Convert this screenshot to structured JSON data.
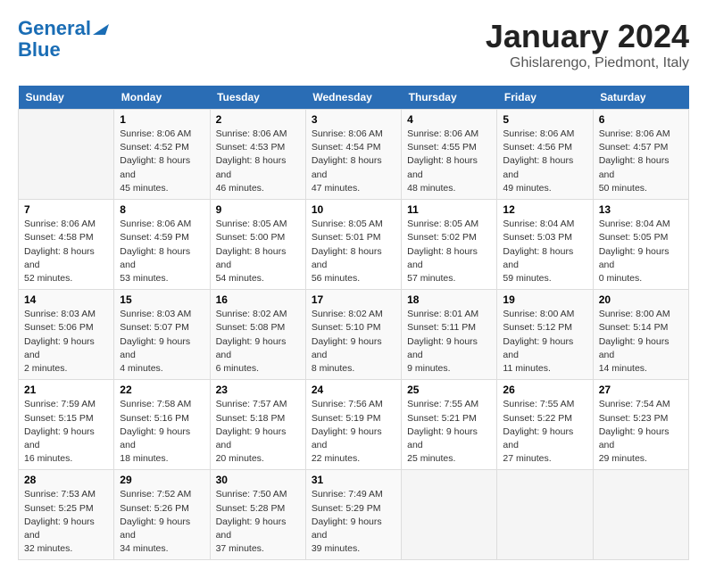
{
  "header": {
    "logo_line1": "General",
    "logo_line2": "Blue",
    "month": "January 2024",
    "location": "Ghislarengo, Piedmont, Italy"
  },
  "weekdays": [
    "Sunday",
    "Monday",
    "Tuesday",
    "Wednesday",
    "Thursday",
    "Friday",
    "Saturday"
  ],
  "weeks": [
    [
      {
        "day": "",
        "sunrise": "",
        "sunset": "",
        "daylight": ""
      },
      {
        "day": "1",
        "sunrise": "Sunrise: 8:06 AM",
        "sunset": "Sunset: 4:52 PM",
        "daylight": "Daylight: 8 hours and 45 minutes."
      },
      {
        "day": "2",
        "sunrise": "Sunrise: 8:06 AM",
        "sunset": "Sunset: 4:53 PM",
        "daylight": "Daylight: 8 hours and 46 minutes."
      },
      {
        "day": "3",
        "sunrise": "Sunrise: 8:06 AM",
        "sunset": "Sunset: 4:54 PM",
        "daylight": "Daylight: 8 hours and 47 minutes."
      },
      {
        "day": "4",
        "sunrise": "Sunrise: 8:06 AM",
        "sunset": "Sunset: 4:55 PM",
        "daylight": "Daylight: 8 hours and 48 minutes."
      },
      {
        "day": "5",
        "sunrise": "Sunrise: 8:06 AM",
        "sunset": "Sunset: 4:56 PM",
        "daylight": "Daylight: 8 hours and 49 minutes."
      },
      {
        "day": "6",
        "sunrise": "Sunrise: 8:06 AM",
        "sunset": "Sunset: 4:57 PM",
        "daylight": "Daylight: 8 hours and 50 minutes."
      }
    ],
    [
      {
        "day": "7",
        "sunrise": "Sunrise: 8:06 AM",
        "sunset": "Sunset: 4:58 PM",
        "daylight": "Daylight: 8 hours and 52 minutes."
      },
      {
        "day": "8",
        "sunrise": "Sunrise: 8:06 AM",
        "sunset": "Sunset: 4:59 PM",
        "daylight": "Daylight: 8 hours and 53 minutes."
      },
      {
        "day": "9",
        "sunrise": "Sunrise: 8:05 AM",
        "sunset": "Sunset: 5:00 PM",
        "daylight": "Daylight: 8 hours and 54 minutes."
      },
      {
        "day": "10",
        "sunrise": "Sunrise: 8:05 AM",
        "sunset": "Sunset: 5:01 PM",
        "daylight": "Daylight: 8 hours and 56 minutes."
      },
      {
        "day": "11",
        "sunrise": "Sunrise: 8:05 AM",
        "sunset": "Sunset: 5:02 PM",
        "daylight": "Daylight: 8 hours and 57 minutes."
      },
      {
        "day": "12",
        "sunrise": "Sunrise: 8:04 AM",
        "sunset": "Sunset: 5:03 PM",
        "daylight": "Daylight: 8 hours and 59 minutes."
      },
      {
        "day": "13",
        "sunrise": "Sunrise: 8:04 AM",
        "sunset": "Sunset: 5:05 PM",
        "daylight": "Daylight: 9 hours and 0 minutes."
      }
    ],
    [
      {
        "day": "14",
        "sunrise": "Sunrise: 8:03 AM",
        "sunset": "Sunset: 5:06 PM",
        "daylight": "Daylight: 9 hours and 2 minutes."
      },
      {
        "day": "15",
        "sunrise": "Sunrise: 8:03 AM",
        "sunset": "Sunset: 5:07 PM",
        "daylight": "Daylight: 9 hours and 4 minutes."
      },
      {
        "day": "16",
        "sunrise": "Sunrise: 8:02 AM",
        "sunset": "Sunset: 5:08 PM",
        "daylight": "Daylight: 9 hours and 6 minutes."
      },
      {
        "day": "17",
        "sunrise": "Sunrise: 8:02 AM",
        "sunset": "Sunset: 5:10 PM",
        "daylight": "Daylight: 9 hours and 8 minutes."
      },
      {
        "day": "18",
        "sunrise": "Sunrise: 8:01 AM",
        "sunset": "Sunset: 5:11 PM",
        "daylight": "Daylight: 9 hours and 9 minutes."
      },
      {
        "day": "19",
        "sunrise": "Sunrise: 8:00 AM",
        "sunset": "Sunset: 5:12 PM",
        "daylight": "Daylight: 9 hours and 11 minutes."
      },
      {
        "day": "20",
        "sunrise": "Sunrise: 8:00 AM",
        "sunset": "Sunset: 5:14 PM",
        "daylight": "Daylight: 9 hours and 14 minutes."
      }
    ],
    [
      {
        "day": "21",
        "sunrise": "Sunrise: 7:59 AM",
        "sunset": "Sunset: 5:15 PM",
        "daylight": "Daylight: 9 hours and 16 minutes."
      },
      {
        "day": "22",
        "sunrise": "Sunrise: 7:58 AM",
        "sunset": "Sunset: 5:16 PM",
        "daylight": "Daylight: 9 hours and 18 minutes."
      },
      {
        "day": "23",
        "sunrise": "Sunrise: 7:57 AM",
        "sunset": "Sunset: 5:18 PM",
        "daylight": "Daylight: 9 hours and 20 minutes."
      },
      {
        "day": "24",
        "sunrise": "Sunrise: 7:56 AM",
        "sunset": "Sunset: 5:19 PM",
        "daylight": "Daylight: 9 hours and 22 minutes."
      },
      {
        "day": "25",
        "sunrise": "Sunrise: 7:55 AM",
        "sunset": "Sunset: 5:21 PM",
        "daylight": "Daylight: 9 hours and 25 minutes."
      },
      {
        "day": "26",
        "sunrise": "Sunrise: 7:55 AM",
        "sunset": "Sunset: 5:22 PM",
        "daylight": "Daylight: 9 hours and 27 minutes."
      },
      {
        "day": "27",
        "sunrise": "Sunrise: 7:54 AM",
        "sunset": "Sunset: 5:23 PM",
        "daylight": "Daylight: 9 hours and 29 minutes."
      }
    ],
    [
      {
        "day": "28",
        "sunrise": "Sunrise: 7:53 AM",
        "sunset": "Sunset: 5:25 PM",
        "daylight": "Daylight: 9 hours and 32 minutes."
      },
      {
        "day": "29",
        "sunrise": "Sunrise: 7:52 AM",
        "sunset": "Sunset: 5:26 PM",
        "daylight": "Daylight: 9 hours and 34 minutes."
      },
      {
        "day": "30",
        "sunrise": "Sunrise: 7:50 AM",
        "sunset": "Sunset: 5:28 PM",
        "daylight": "Daylight: 9 hours and 37 minutes."
      },
      {
        "day": "31",
        "sunrise": "Sunrise: 7:49 AM",
        "sunset": "Sunset: 5:29 PM",
        "daylight": "Daylight: 9 hours and 39 minutes."
      },
      {
        "day": "",
        "sunrise": "",
        "sunset": "",
        "daylight": ""
      },
      {
        "day": "",
        "sunrise": "",
        "sunset": "",
        "daylight": ""
      },
      {
        "day": "",
        "sunrise": "",
        "sunset": "",
        "daylight": ""
      }
    ]
  ]
}
